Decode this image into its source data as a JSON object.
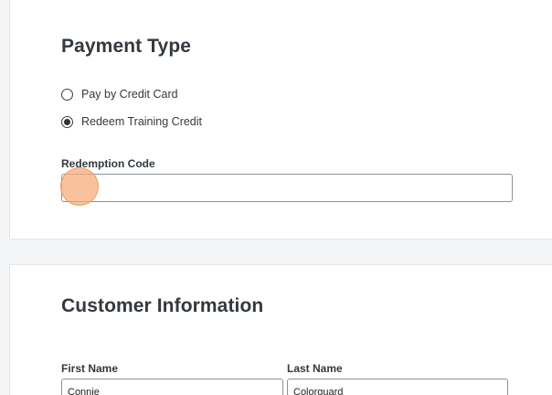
{
  "payment": {
    "title": "Payment Type",
    "options": [
      {
        "label": "Pay by Credit Card",
        "selected": false
      },
      {
        "label": "Redeem Training Credit",
        "selected": true
      }
    ],
    "redemption_code": {
      "label": "Redemption Code",
      "value": ""
    }
  },
  "customer": {
    "title": "Customer Information",
    "first_name": {
      "label": "First Name",
      "value": "Connie"
    },
    "last_name": {
      "label": "Last Name",
      "value": "Colorguard"
    }
  },
  "colors": {
    "click_marker": "#f6aa78",
    "border": "#8d9297",
    "text": "#33393e"
  }
}
